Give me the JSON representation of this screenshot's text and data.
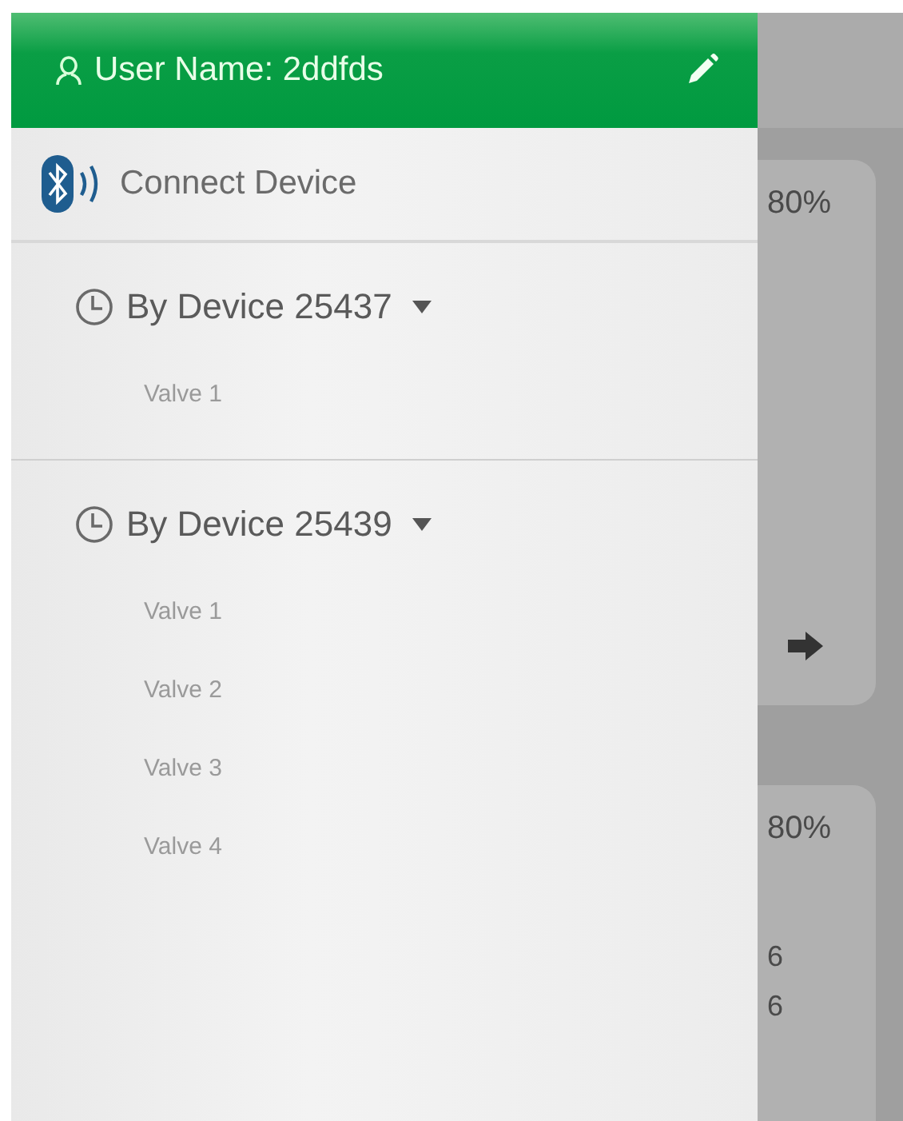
{
  "drawer": {
    "user_label": "User Name: 2ddfds",
    "connect_label": "Connect Device",
    "devices": [
      {
        "name": "By Device 25437",
        "expanded": true,
        "valves": [
          "Valve 1"
        ]
      },
      {
        "name": "By Device 25439",
        "expanded": true,
        "valves": [
          "Valve 1",
          "Valve 2",
          "Valve 3",
          "Valve 4"
        ]
      }
    ]
  },
  "cards": [
    {
      "reading": "80%",
      "has_arrow": true
    },
    {
      "reading": "80%",
      "lines": [
        "6",
        "6"
      ],
      "has_arrow": false
    }
  ]
}
